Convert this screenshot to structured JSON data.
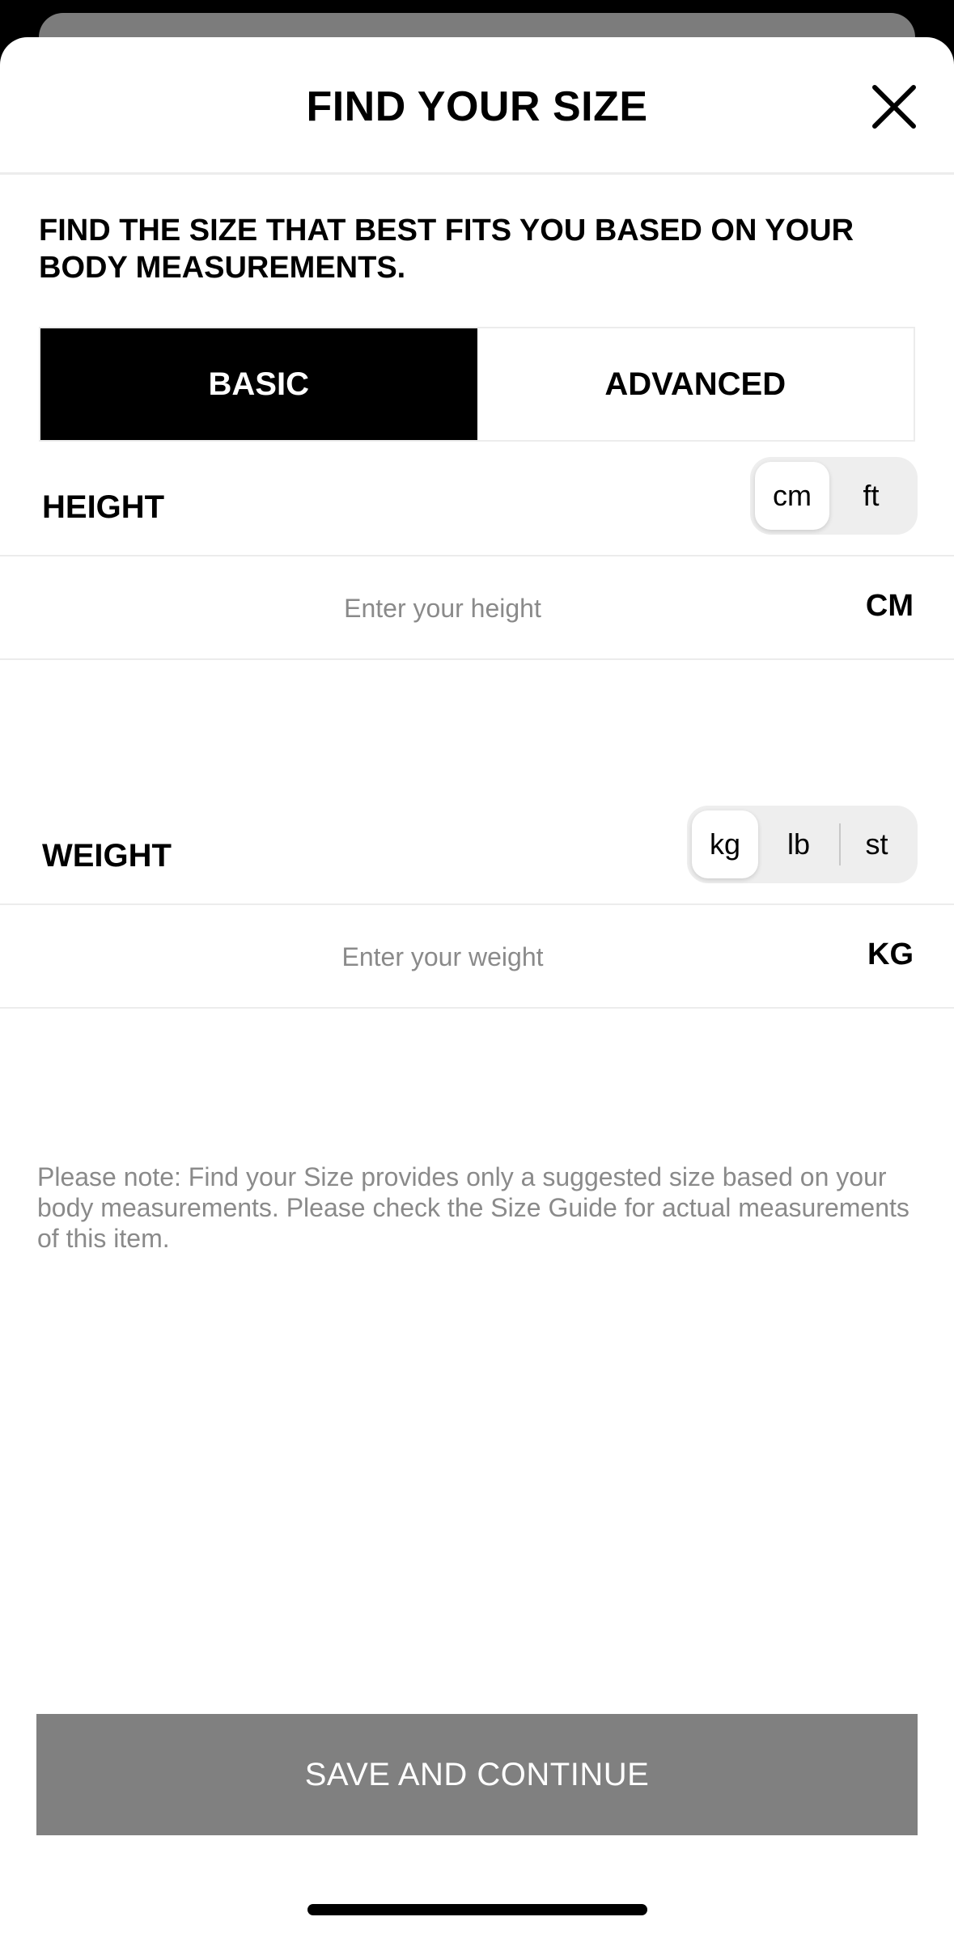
{
  "header": {
    "title": "FIND YOUR SIZE",
    "close_icon": "close-icon"
  },
  "intro": "FIND THE SIZE THAT BEST FITS YOU BASED ON YOUR BODY MEASUREMENTS.",
  "mode_tabs": [
    {
      "label": "BASIC",
      "selected": true
    },
    {
      "label": "ADVANCED",
      "selected": false
    }
  ],
  "height": {
    "label": "HEIGHT",
    "units": [
      "cm",
      "ft"
    ],
    "selected_unit": "cm",
    "placeholder": "Enter your height",
    "value": "",
    "suffix": "CM"
  },
  "weight": {
    "label": "WEIGHT",
    "units": [
      "kg",
      "lb",
      "st"
    ],
    "selected_unit": "kg",
    "placeholder": "Enter your weight",
    "value": "",
    "suffix": "KG"
  },
  "note": "Please note: Find your Size provides only a suggested size based on your body measurements. Please check the Size Guide for actual measurements of this item.",
  "save_button": "SAVE AND CONTINUE",
  "colors": {
    "tab_active_bg": "#000000",
    "save_button_bg": "#808080",
    "placeholder": "#8a8a8a"
  }
}
